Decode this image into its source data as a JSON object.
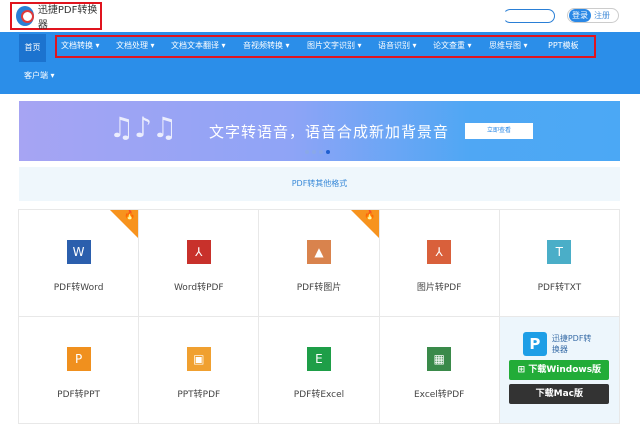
{
  "header": {
    "logo_text": "迅捷PDF转换器",
    "login": "登录",
    "register": "注册"
  },
  "nav": {
    "home": "首页",
    "items": [
      "文档转换",
      "文档处理",
      "文档文本翻译",
      "音视频转换",
      "图片文字识别",
      "语音识别",
      "论文查重",
      "思维导图",
      "PPT模板"
    ],
    "client": "客户端"
  },
  "banner": {
    "text": "文字转语音，语音合成新加背景音",
    "button": "立即查看",
    "slide_count": 4,
    "active_slide": 4
  },
  "section_title": "PDF转其他格式",
  "tools": [
    {
      "label": "PDF转Word",
      "glyph": "W",
      "color": "#2b5fad",
      "hot": true
    },
    {
      "label": "Word转PDF",
      "glyph": "⅄",
      "color": "#c8312b",
      "hot": false
    },
    {
      "label": "PDF转图片",
      "glyph": "▲",
      "color": "#d9834d",
      "hot": true
    },
    {
      "label": "图片转PDF",
      "glyph": "⅄",
      "color": "#d9603b",
      "hot": false
    },
    {
      "label": "PDF转TXT",
      "glyph": "T",
      "color": "#4aaec8",
      "hot": false
    },
    {
      "label": "PDF转PPT",
      "glyph": "P",
      "color": "#f0901e",
      "hot": false
    },
    {
      "label": "PPT转PDF",
      "glyph": "▣",
      "color": "#f0a030",
      "hot": false
    },
    {
      "label": "PDF转Excel",
      "glyph": "E",
      "color": "#1e9e48",
      "hot": false
    },
    {
      "label": "Excel转PDF",
      "glyph": "▦",
      "color": "#3a8a4a",
      "hot": false
    }
  ],
  "download": {
    "app_name": "迅捷PDF转换器",
    "windows": "下载Windows版",
    "mac": "下载Mac版",
    "windows_color": "#22ac38",
    "mac_color": "#333333"
  }
}
